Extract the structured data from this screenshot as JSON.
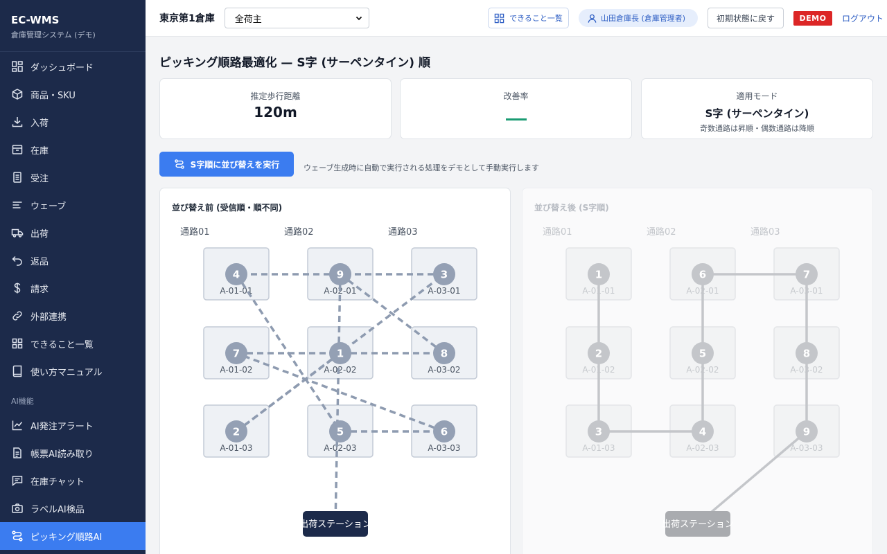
{
  "brand": {
    "title": "EC-WMS",
    "subtitle": "倉庫管理システム (デモ)"
  },
  "nav": [
    {
      "label": "ダッシュボード",
      "icon": "dashboard-icon"
    },
    {
      "label": "商品・SKU",
      "icon": "box-icon"
    },
    {
      "label": "入荷",
      "icon": "download-icon"
    },
    {
      "label": "在庫",
      "icon": "archive-icon"
    },
    {
      "label": "受注",
      "icon": "document-icon"
    },
    {
      "label": "ウェーブ",
      "icon": "wave-lines-icon"
    },
    {
      "label": "出荷",
      "icon": "truck-icon"
    },
    {
      "label": "返品",
      "icon": "return-arrow-icon"
    },
    {
      "label": "請求",
      "icon": "dollar-icon"
    },
    {
      "label": "外部連携",
      "icon": "link-icon"
    },
    {
      "label": "できること一覧",
      "icon": "grid-icon"
    },
    {
      "label": "使い方マニュアル",
      "icon": "book-icon"
    }
  ],
  "nav_section_ai": "AI機能",
  "nav_ai": [
    {
      "label": "AI発注アラート",
      "icon": "line-chart-icon"
    },
    {
      "label": "帳票AI読み取り",
      "icon": "file-text-icon"
    },
    {
      "label": "在庫チャット",
      "icon": "chat-icon"
    },
    {
      "label": "ラベルAI検品",
      "icon": "camera-icon"
    },
    {
      "label": "ピッキング順路AI",
      "icon": "route-icon",
      "active": true
    }
  ],
  "topbar": {
    "warehouse": "東京第1倉庫",
    "owner_selected": "全荷主",
    "features_label": "できること一覧",
    "user_label": "山田倉庫長 (倉庫管理者)",
    "reset_label": "初期状態に戻す",
    "demo_badge": "DEMO",
    "logout_label": "ログアウト"
  },
  "page": {
    "title": "ピッキング順路最適化 — S字 (サーペンタイン) 順",
    "stats": {
      "distance_label": "推定歩行距離",
      "distance_value": "120m",
      "improvement_label": "改善率",
      "mode_label": "適用モード",
      "mode_value": "S字 (サーペンタイン)",
      "mode_sub": "奇数通路は昇順・偶数通路は降順"
    },
    "run_button": "S字順に並び替えを実行",
    "run_note": "ウェーブ生成時に自動で実行される処理をデモとして手動実行します"
  },
  "panels": {
    "before": {
      "title": "並び替え前 (受信順・順不同)",
      "aisles": [
        "通路01",
        "通路02",
        "通路03"
      ],
      "station": "出荷ステーション",
      "picks": [
        {
          "slot": "A-01-01",
          "order": "4"
        },
        {
          "slot": "A-02-01",
          "order": "9"
        },
        {
          "slot": "A-03-01",
          "order": "3"
        },
        {
          "slot": "A-01-02",
          "order": "7"
        },
        {
          "slot": "A-02-02",
          "order": "1"
        },
        {
          "slot": "A-03-02",
          "order": "8"
        },
        {
          "slot": "A-01-03",
          "order": "2"
        },
        {
          "slot": "A-02-03",
          "order": "5"
        },
        {
          "slot": "A-03-03",
          "order": "6"
        }
      ]
    },
    "after": {
      "title": "並び替え後 (S字順)",
      "aisles": [
        "通路01",
        "通路02",
        "通路03"
      ],
      "station": "出荷ステーション",
      "picks": [
        {
          "slot": "A-01-01",
          "order": "1"
        },
        {
          "slot": "A-02-01",
          "order": "6"
        },
        {
          "slot": "A-03-01",
          "order": "7"
        },
        {
          "slot": "A-01-02",
          "order": "2"
        },
        {
          "slot": "A-02-02",
          "order": "5"
        },
        {
          "slot": "A-03-02",
          "order": "8"
        },
        {
          "slot": "A-01-03",
          "order": "3"
        },
        {
          "slot": "A-02-03",
          "order": "4"
        },
        {
          "slot": "A-03-03",
          "order": "9"
        }
      ]
    }
  },
  "colors": {
    "sidebar": "#1c2a4a",
    "accent": "#3b7cf0",
    "demo": "#dc2626",
    "improvement_dash": "#1a9b72",
    "node_before": "#94a0b4",
    "node_after": "#c4c6ca",
    "station_before": "#1c2a4a",
    "station_after": "#a9abaf"
  }
}
